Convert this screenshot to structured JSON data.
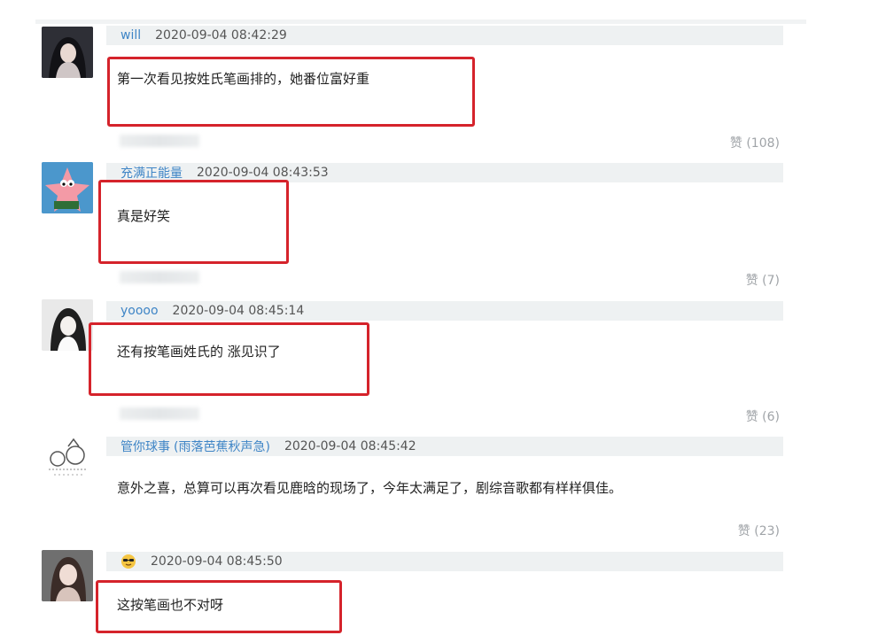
{
  "comments": [
    {
      "user": "will",
      "time": "2020-09-04 08:42:29",
      "text": "第一次看见按姓氏笔画排的，她番位富好重",
      "likes": "赞 (108)"
    },
    {
      "user": "充满正能量",
      "time": "2020-09-04 08:43:53",
      "text": "真是好笑",
      "likes": "赞 (7)"
    },
    {
      "user": "yoooo",
      "time": "2020-09-04 08:45:14",
      "text": "还有按笔画姓氏的 涨见识了",
      "likes": "赞 (6)"
    },
    {
      "user": "管你球事",
      "user_note": "(雨落芭蕉秋声急)",
      "time": "2020-09-04 08:45:42",
      "text": "意外之喜，总算可以再次看见鹿晗的现场了，今年太满足了，剧综音歌都有样样俱佳。",
      "likes": "赞 (23)"
    },
    {
      "user_icon": "sunglasses-emoji-icon",
      "time": "2020-09-04 08:45:50",
      "text": "这按笔画也不对呀"
    }
  ],
  "colors": {
    "username": "#3f85c6",
    "highlight": "#d5232b",
    "meta_bg": "#eef1f2",
    "likes": "#a0a4a8"
  },
  "avatars": [
    "dark-hair-girl-avatar",
    "patrick-star-avatar",
    "black-white-portrait-avatar",
    "doodle-avatar",
    "woman-portrait-avatar"
  ]
}
